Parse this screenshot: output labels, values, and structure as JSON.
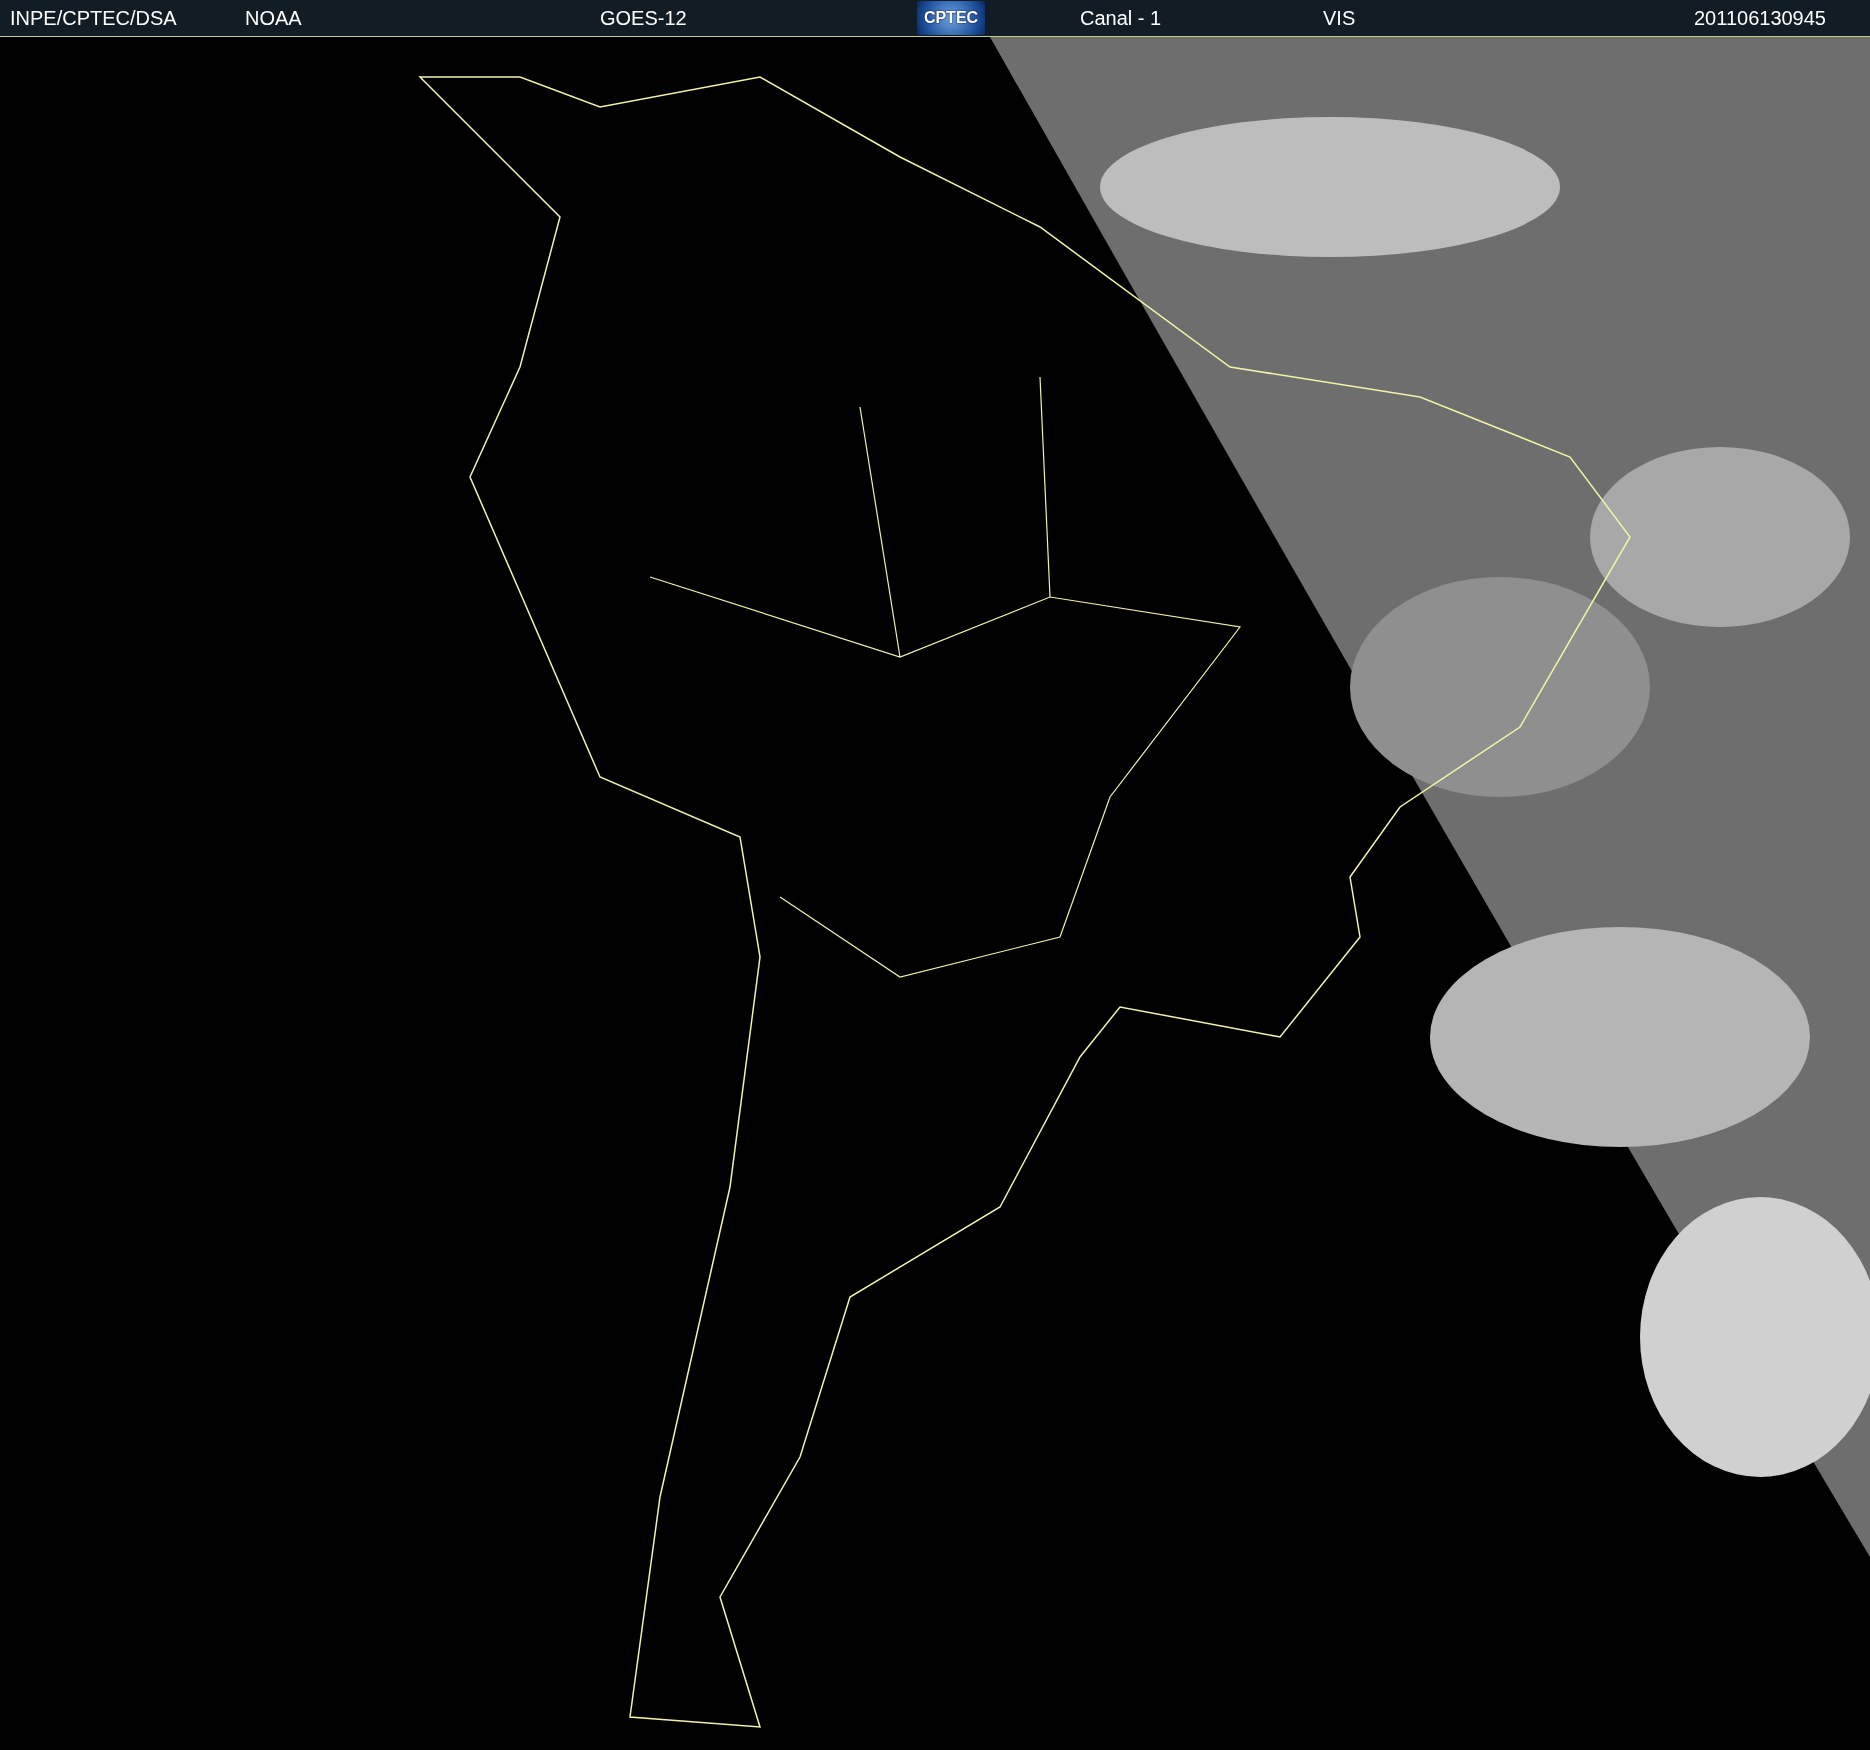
{
  "header": {
    "source": "INPE/CPTEC/DSA",
    "agency": "NOAA",
    "satellite": "GOES-12",
    "logo": "CPTEC",
    "channel": "Canal - 1",
    "band": "VIS",
    "timestamp": "201106130945"
  }
}
